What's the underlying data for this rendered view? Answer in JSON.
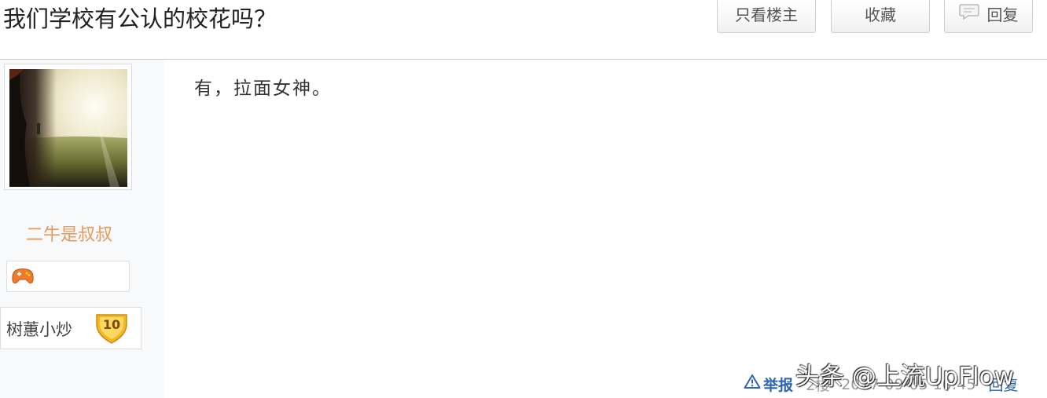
{
  "thread": {
    "title": "我们学校有公认的校花吗？"
  },
  "toolbar": {
    "only_op_label": "只看楼主",
    "favorite_label": "收藏",
    "reply_label": "回复"
  },
  "author": {
    "avatar_icon": "landscape-photo",
    "username": "二牛是叔叔",
    "badge_icon": "game-controller-badge",
    "level_title": "树蕙小炒",
    "level_number": "10",
    "username_color": "#e49a5c"
  },
  "post": {
    "content": "有，拉面女神。"
  },
  "meta": {
    "report_label": "举报",
    "floor": "2楼",
    "timestamp": "2017-09-05 10:45",
    "reply_label": "回复"
  },
  "watermark": {
    "text": "头条 @上流UpFlow"
  },
  "colors": {
    "link": "#2d64b3",
    "sidebar_bg": "#f7f9fb"
  }
}
